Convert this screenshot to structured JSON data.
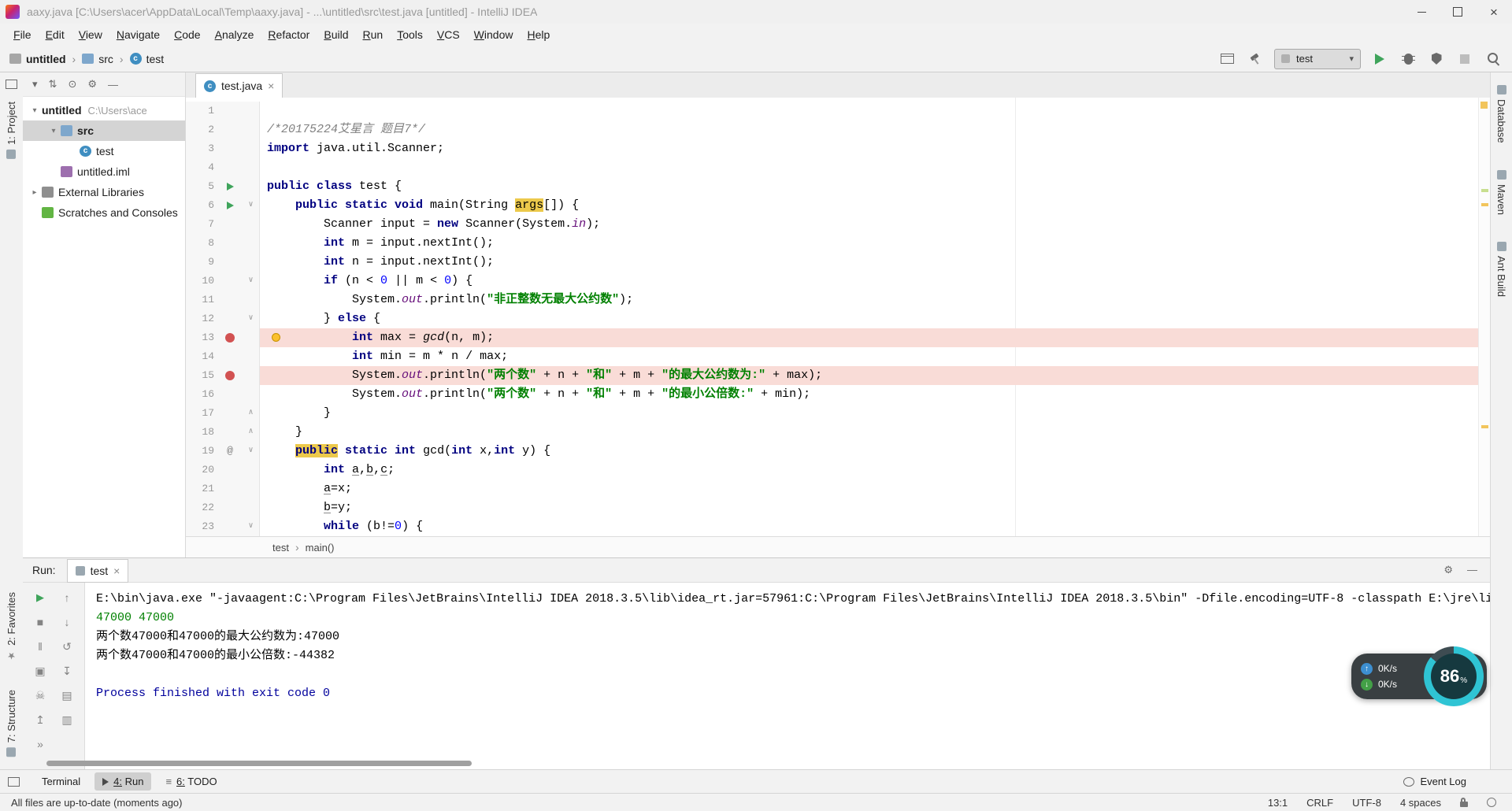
{
  "colors": {
    "accent_green": "#3fa45b",
    "breakpoint_red": "#d25252",
    "keyword_blue": "#000080",
    "string_green": "#008000",
    "comment_gray": "#808080",
    "field_purple": "#660e7a",
    "breakpoint_line_bg": "#f9dcd7",
    "highlight_yellow": "#ecc94b",
    "console_input_green": "#008000",
    "console_system_blue": "#00009c",
    "gauge_teal": "#2fc4d4"
  },
  "icons": {
    "gear": "⚙",
    "minus": "—",
    "close": "×",
    "chevron_down": "▾",
    "chevron_right": "▸",
    "fold_open": "∨",
    "fold_close": "∧",
    "up_arrow": "↑",
    "down_arrow": "↓",
    "play": "▶",
    "stop": "■",
    "pause": "‖",
    "camera": "▣",
    "skull": "☠",
    "exit": "↥",
    "more": "»",
    "restore": "↺",
    "scroll_end": "↧",
    "print": "▤",
    "clear": "▥",
    "star": "★",
    "todo_list": "≡",
    "swap": "⇅",
    "locate": "⊙",
    "caret": "▾",
    "crumb_sep": "›",
    "class_letter": "c"
  },
  "window": {
    "title": "aaxy.java [C:\\Users\\acer\\AppData\\Local\\Temp\\aaxy.java] - ...\\untitled\\src\\test.java [untitled] - IntelliJ IDEA"
  },
  "menubar": {
    "items": [
      "File",
      "Edit",
      "View",
      "Navigate",
      "Code",
      "Analyze",
      "Refactor",
      "Build",
      "Run",
      "Tools",
      "VCS",
      "Window",
      "Help"
    ]
  },
  "navbar": {
    "crumbs": [
      "untitled",
      "src",
      "test"
    ],
    "run_config": "test"
  },
  "left_stripe": {
    "top": "1: Project",
    "bottom": [
      "2: Favorites",
      "7: Structure"
    ]
  },
  "right_stripe": [
    "Database",
    "Maven",
    "Ant Build"
  ],
  "project": {
    "rows": [
      {
        "level": 0,
        "chevron": "down",
        "icon": null,
        "label": "untitled",
        "sub": "C:\\Users\\ace",
        "bold": true
      },
      {
        "level": 1,
        "chevron": "down",
        "icon": "folder-src",
        "label": "src",
        "bold": true,
        "selected": true
      },
      {
        "level": 2,
        "chevron": null,
        "icon": "class",
        "label": "test"
      },
      {
        "level": 1,
        "chevron": null,
        "icon": "iml",
        "label": "untitled.iml"
      },
      {
        "level": 0,
        "chevron": "right",
        "icon": "libs",
        "label": "External Libraries"
      },
      {
        "level": 0,
        "chevron": null,
        "icon": "scratches",
        "label": "Scratches and Consoles"
      }
    ]
  },
  "editor": {
    "tab": "test.java",
    "breadcrumbs": [
      "test",
      "main()"
    ],
    "lines": [
      {
        "n": 1,
        "t": []
      },
      {
        "n": 2,
        "t": [
          [
            "/*20175224艾星言 题目7*/",
            "c"
          ]
        ]
      },
      {
        "n": 3,
        "t": [
          [
            "import",
            "k"
          ],
          [
            " java.util.Scanner;",
            "p"
          ]
        ]
      },
      {
        "n": 4,
        "t": []
      },
      {
        "n": 5,
        "t": [
          [
            "public class",
            "k"
          ],
          [
            " test {",
            "p"
          ]
        ],
        "g": {
          "run": true
        }
      },
      {
        "n": 6,
        "t": [
          [
            "    ",
            "p"
          ],
          [
            "public static void",
            "k"
          ],
          [
            " main(String ",
            "p"
          ],
          [
            "args",
            "hl"
          ],
          [
            "[]) {",
            "p"
          ]
        ],
        "g": {
          "run": true,
          "fold": "d"
        }
      },
      {
        "n": 7,
        "t": [
          [
            "        Scanner input = ",
            "p"
          ],
          [
            "new",
            "k"
          ],
          [
            " Scanner(System.",
            "p"
          ],
          [
            "in",
            "f"
          ],
          [
            ");",
            "p"
          ]
        ]
      },
      {
        "n": 8,
        "t": [
          [
            "        ",
            "p"
          ],
          [
            "int",
            "k"
          ],
          [
            " m = input.nextInt();",
            "p"
          ]
        ]
      },
      {
        "n": 9,
        "t": [
          [
            "        ",
            "p"
          ],
          [
            "int",
            "k"
          ],
          [
            " n = input.nextInt();",
            "p"
          ]
        ]
      },
      {
        "n": 10,
        "t": [
          [
            "        ",
            "p"
          ],
          [
            "if",
            "k"
          ],
          [
            " (n < ",
            "p"
          ],
          [
            "0",
            "n"
          ],
          [
            " || m < ",
            "p"
          ],
          [
            "0",
            "n"
          ],
          [
            ") {",
            "p"
          ]
        ],
        "g": {
          "fold": "d"
        }
      },
      {
        "n": 11,
        "t": [
          [
            "            System.",
            "p"
          ],
          [
            "out",
            "f"
          ],
          [
            ".println(",
            "p"
          ],
          [
            "\"非正整数无最大公约数\"",
            "s"
          ],
          [
            ");",
            "p"
          ]
        ]
      },
      {
        "n": 12,
        "t": [
          [
            "        } ",
            "p"
          ],
          [
            "else",
            "k"
          ],
          [
            " {",
            "p"
          ]
        ],
        "g": {
          "fold": "d"
        }
      },
      {
        "n": 13,
        "t": [
          [
            "            ",
            "p"
          ],
          [
            "int",
            "k"
          ],
          [
            " max = ",
            "p"
          ],
          [
            "gcd",
            "m"
          ],
          [
            "(n, m);",
            "p"
          ]
        ],
        "g": {
          "bp": true,
          "bulb": true,
          "bg": true
        }
      },
      {
        "n": 14,
        "t": [
          [
            "            ",
            "p"
          ],
          [
            "int",
            "k"
          ],
          [
            " min = m * n / max;",
            "p"
          ]
        ]
      },
      {
        "n": 15,
        "t": [
          [
            "            System.",
            "p"
          ],
          [
            "out",
            "f"
          ],
          [
            ".println(",
            "p"
          ],
          [
            "\"两个数\"",
            "s"
          ],
          [
            " + n + ",
            "p"
          ],
          [
            "\"和\"",
            "s"
          ],
          [
            " + m + ",
            "p"
          ],
          [
            "\"的最大公约数为:\"",
            "s"
          ],
          [
            " + max);",
            "p"
          ]
        ],
        "g": {
          "bp": true,
          "bg": true
        }
      },
      {
        "n": 16,
        "t": [
          [
            "            System.",
            "p"
          ],
          [
            "out",
            "f"
          ],
          [
            ".println(",
            "p"
          ],
          [
            "\"两个数\"",
            "s"
          ],
          [
            " + n + ",
            "p"
          ],
          [
            "\"和\"",
            "s"
          ],
          [
            " + m + ",
            "p"
          ],
          [
            "\"的最小公倍数:\"",
            "s"
          ],
          [
            " + min);",
            "p"
          ]
        ]
      },
      {
        "n": 17,
        "t": [
          [
            "        }",
            "p"
          ]
        ],
        "g": {
          "fold": "u"
        }
      },
      {
        "n": 18,
        "t": [
          [
            "    }",
            "p"
          ]
        ],
        "g": {
          "fold": "u"
        }
      },
      {
        "n": 19,
        "t": [
          [
            "    ",
            "p"
          ],
          [
            "public",
            "khl"
          ],
          [
            " ",
            "p"
          ],
          [
            "static int",
            "k"
          ],
          [
            " gcd(",
            "p"
          ],
          [
            "int",
            "k"
          ],
          [
            " x,",
            "p"
          ],
          [
            "int",
            "k"
          ],
          [
            " y) {",
            "p"
          ]
        ],
        "g": {
          "at": true,
          "fold": "d"
        }
      },
      {
        "n": 20,
        "t": [
          [
            "        ",
            "p"
          ],
          [
            "int",
            "k"
          ],
          [
            " ",
            "p"
          ],
          [
            "a",
            "u"
          ],
          [
            ",",
            "p"
          ],
          [
            "b",
            "u"
          ],
          [
            ",",
            "p"
          ],
          [
            "c",
            "u"
          ],
          [
            ";",
            "p"
          ]
        ]
      },
      {
        "n": 21,
        "t": [
          [
            "        ",
            "p"
          ],
          [
            "a",
            "u"
          ],
          [
            "=x;",
            "p"
          ]
        ]
      },
      {
        "n": 22,
        "t": [
          [
            "        ",
            "p"
          ],
          [
            "b",
            "u"
          ],
          [
            "=y;",
            "p"
          ]
        ]
      },
      {
        "n": 23,
        "t": [
          [
            "        ",
            "p"
          ],
          [
            "while",
            "k"
          ],
          [
            " (b!=",
            "p"
          ],
          [
            "0",
            "n"
          ],
          [
            ") {",
            "p"
          ]
        ],
        "g": {
          "fold": "d"
        }
      }
    ]
  },
  "run": {
    "title": "Run:",
    "tab": "test",
    "console": [
      {
        "cls": "plain",
        "text": "E:\\bin\\java.exe \"-javaagent:C:\\Program Files\\JetBrains\\IntelliJ IDEA 2018.3.5\\lib\\idea_rt.jar=57961:C:\\Program Files\\JetBrains\\IntelliJ IDEA 2018.3.5\\bin\" -Dfile.encoding=UTF-8 -classpath E:\\jre\\lib\\charsets.jar;E:\\jre\\lib"
      },
      {
        "cls": "input",
        "text": "47000 47000"
      },
      {
        "cls": "plain",
        "text": "两个数47000和47000的最大公约数为:47000"
      },
      {
        "cls": "plain",
        "text": "两个数47000和47000的最小公倍数:-44382"
      },
      {
        "cls": "blank",
        "text": ""
      },
      {
        "cls": "sys",
        "text": "Process finished with exit code 0"
      }
    ]
  },
  "bottom_bar": {
    "items": [
      "Terminal",
      "4: Run",
      "6: TODO"
    ],
    "event_log": "Event Log"
  },
  "status_bar": {
    "message": "All files are up-to-date (moments ago)",
    "position": "13:1",
    "line_sep": "CRLF",
    "encoding": "UTF-8",
    "indent": "4 spaces"
  },
  "speed_widget": {
    "up": "0K/s",
    "down": "0K/s",
    "percent": 86,
    "unit": "%"
  }
}
